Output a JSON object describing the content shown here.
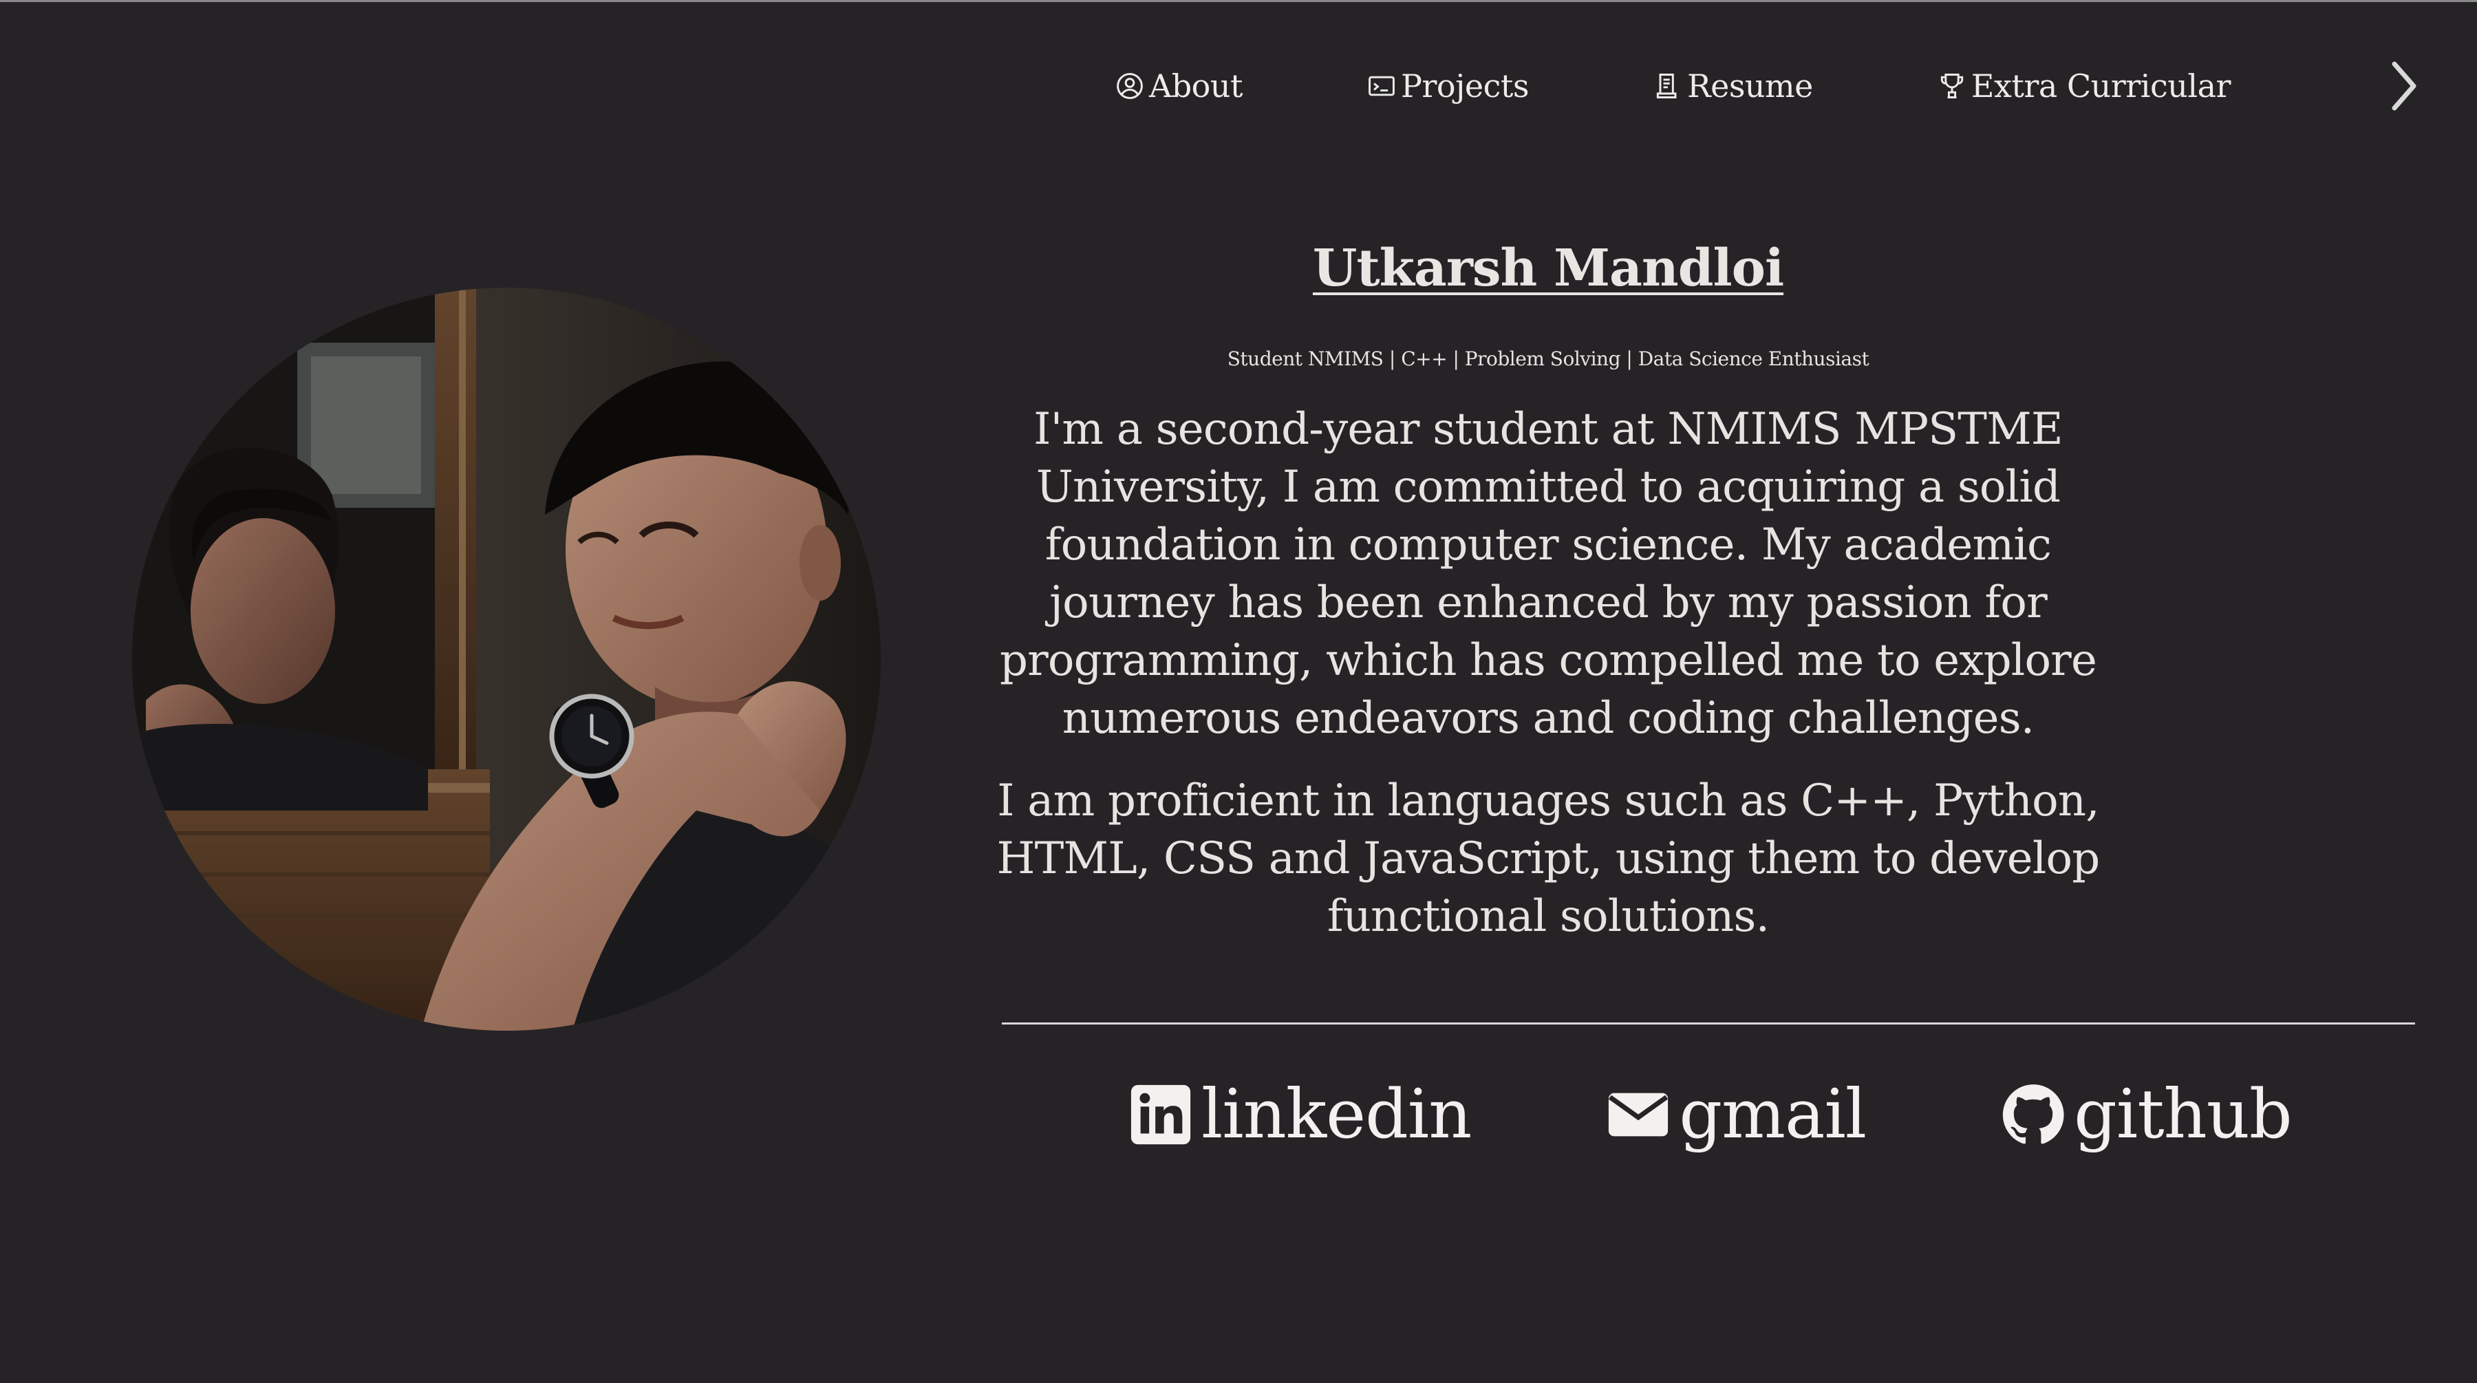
{
  "nav": {
    "items": [
      {
        "label": "About",
        "icon": "user-circle-icon"
      },
      {
        "label": "Projects",
        "icon": "terminal-icon"
      },
      {
        "label": "Resume",
        "icon": "document-icon"
      },
      {
        "label": "Extra Curricular",
        "icon": "trophy-icon"
      }
    ],
    "next_icon": "chevron-right-icon"
  },
  "profile": {
    "name": "Utkarsh Mandloi",
    "tagline": "Student NMIMS | C++ | Problem Solving | Data Science Enthusiast",
    "paragraphs": [
      "I'm a second-year student at NMIMS MPSTME University, I am committed to acquiring a solid foundation in computer science. My academic journey has been enhanced by my passion for programming, which has compelled me to explore numerous endeavors and coding challenges.",
      "I am proficient in languages such as C++, Python, HTML, CSS and JavaScript, using them to develop functional solutions."
    ]
  },
  "social": [
    {
      "label": "linkedin",
      "icon": "linkedin-icon"
    },
    {
      "label": "gmail",
      "icon": "mail-icon"
    },
    {
      "label": "github",
      "icon": "github-icon"
    }
  ],
  "colors": {
    "background": "#252326",
    "text": "#ecebe9",
    "divider": "#d8d8d8"
  }
}
